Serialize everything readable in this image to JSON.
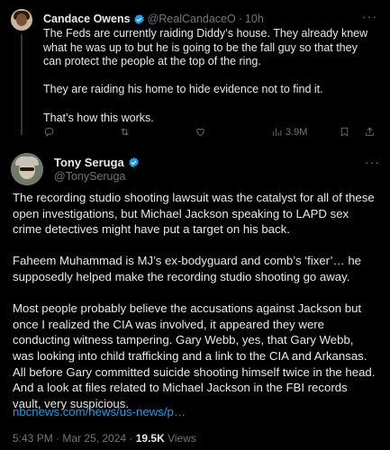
{
  "quoted_post": {
    "author_name": "Candace Owens",
    "handle": "@RealCandaceO",
    "separator": "·",
    "time": "10h",
    "paragraphs": [
      "The Feds are currently raiding Diddy’s house. They already knew what he was up to but he is going to be the fall guy so that they can protect the people at the top of the ring.",
      "They are raiding his home to hide evidence not to find it.",
      "That’s how this works."
    ],
    "views": "3.9M",
    "icons": [
      "reply-icon",
      "repost-icon",
      "like-icon",
      "views-icon",
      "bookmark-icon",
      "share-icon"
    ]
  },
  "main_post": {
    "author_name": "Tony Seruga",
    "handle": "@TonySeruga",
    "paragraphs": [
      "The recording studio shooting lawsuit was the catalyst for all of these open investigations, but Michael Jackson speaking to LAPD sex crime detectives might have put a target on his back.",
      "Faheem Muhammad is MJ’s ex-bodyguard and comb’s ‘fixer’… he supposedly helped make the recording studio shooting go away.",
      "Most people probably believe the accusations against Jackson but once I realized the CIA was involved, it appeared they were conducting witness tampering. Gary Webb, yes, that Gary Webb, was looking into child trafficking and a link to the CIA and Arkansas. All before Gary committed suicide shooting himself twice in the head. And a look at files related to Michael Jackson in the FBI records vault, very suspicious."
    ],
    "link_text": "nbcnews.com/news/us-news/p…",
    "timestamp": "5:43 PM · Mar 25, 2024 · ",
    "views_count": "19.5K",
    "views_label": " Views"
  },
  "colors": {
    "background": "#000000",
    "text": "#e7e9ea",
    "muted": "#71767b",
    "link": "#1d9bf0",
    "verified": "#1d9bf0"
  }
}
